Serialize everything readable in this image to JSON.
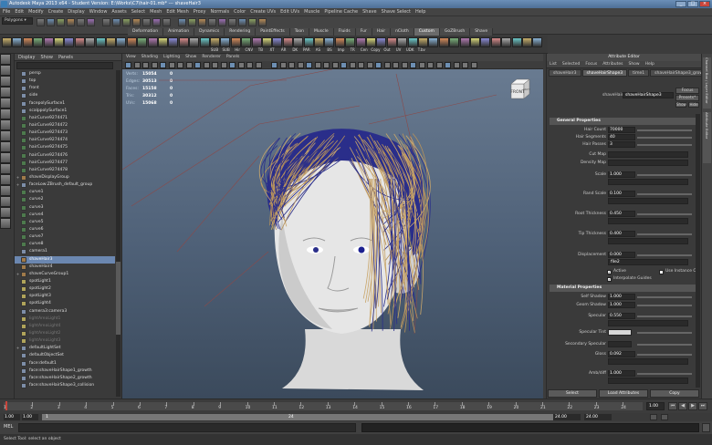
{
  "window": {
    "title": "Autodesk Maya 2013 x64 - Student Version: E:\\Works\\C7\\hair-01.mb* --- shaveHair3"
  },
  "menubar": [
    "File",
    "Edit",
    "Modify",
    "Create",
    "Display",
    "Window",
    "Assets",
    "Select",
    "Mesh",
    "Edit Mesh",
    "Proxy",
    "Normals",
    "Color",
    "Create UVs",
    "Edit UVs",
    "Muscle",
    "Pipeline Cache",
    "Shave",
    "Shave Select",
    "Help"
  ],
  "statusline": {
    "mode": "Polygons"
  },
  "shelf": {
    "tabs": [
      "Deformation",
      "Animation",
      "Dynamics",
      "Rendering",
      "PaintEffects",
      "Toon",
      "Muscle",
      "Fluids",
      "Fur",
      "Hair",
      "nCloth",
      "Custom",
      "GoZBrush",
      "Shave"
    ],
    "active_tab": "Custom",
    "labels": [
      "SUB",
      "SUB",
      "Hir",
      "CNV",
      "TB",
      "XT",
      "AR",
      "DK",
      "PAR",
      "AS",
      "BS",
      "Imp",
      "TR",
      "Cen",
      "Copy",
      "Out",
      "UV",
      "UDK",
      "T.bv"
    ]
  },
  "outliner": {
    "menu": [
      "Display",
      "Show",
      "Panels"
    ],
    "items": [
      {
        "label": "persp",
        "state": ""
      },
      {
        "label": "top",
        "state": ""
      },
      {
        "label": "front",
        "state": ""
      },
      {
        "label": "side",
        "state": ""
      },
      {
        "label": "facepolySurface1",
        "state": ""
      },
      {
        "label": "scalppolySurface1",
        "state": ""
      },
      {
        "label": "hairCurve9274471",
        "state": ""
      },
      {
        "label": "hairCurve9274472",
        "state": ""
      },
      {
        "label": "hairCurve9274473",
        "state": ""
      },
      {
        "label": "hairCurve9274474",
        "state": ""
      },
      {
        "label": "hairCurve9274475",
        "state": ""
      },
      {
        "label": "hairCurve9274476",
        "state": ""
      },
      {
        "label": "hairCurve9274477",
        "state": ""
      },
      {
        "label": "hairCurve9274478",
        "state": ""
      },
      {
        "label": "shaveDisplayGroup",
        "state": ""
      },
      {
        "label": "faceLow:ZBrush_default_group",
        "state": ""
      },
      {
        "label": "curve1",
        "state": ""
      },
      {
        "label": "curve2",
        "state": ""
      },
      {
        "label": "curve3",
        "state": ""
      },
      {
        "label": "curve4",
        "state": ""
      },
      {
        "label": "curve5",
        "state": ""
      },
      {
        "label": "curve6",
        "state": ""
      },
      {
        "label": "curve7",
        "state": ""
      },
      {
        "label": "curve8",
        "state": ""
      },
      {
        "label": "camera1",
        "state": ""
      },
      {
        "label": "shaveHair3",
        "state": "sel"
      },
      {
        "label": "shaveHair4",
        "state": ""
      },
      {
        "label": "shaveCurveGroup1",
        "state": ""
      },
      {
        "label": "spotLight1",
        "state": ""
      },
      {
        "label": "spotLight2",
        "state": ""
      },
      {
        "label": "spotLight3",
        "state": ""
      },
      {
        "label": "spotLight4",
        "state": ""
      },
      {
        "label": "camera3:camera3",
        "state": ""
      },
      {
        "label": "lightAreaLight1",
        "state": "dim"
      },
      {
        "label": "lightAreaLight4",
        "state": "dim"
      },
      {
        "label": "lightAreaLight2",
        "state": "dim"
      },
      {
        "label": "lightAreaLight3",
        "state": "dim"
      },
      {
        "label": "defaultLightSet",
        "state": ""
      },
      {
        "label": "defaultObjectSet",
        "state": ""
      },
      {
        "label": "face:default1",
        "state": ""
      },
      {
        "label": "face:shaveHairShape1_growth",
        "state": ""
      },
      {
        "label": "face:shaveHairShape2_growth",
        "state": ""
      },
      {
        "label": "face:shaveHairShape3_collision",
        "state": ""
      }
    ]
  },
  "viewport": {
    "menu": [
      "View",
      "Shading",
      "Lighting",
      "Show",
      "Renderer",
      "Panels"
    ],
    "hud": [
      {
        "key": "Verts:",
        "v1": "15054",
        "v2": "0"
      },
      {
        "key": "Edges:",
        "v1": "30513",
        "v2": "0"
      },
      {
        "key": "Faces:",
        "v1": "15158",
        "v2": "0"
      },
      {
        "key": "Tris:",
        "v1": "30312",
        "v2": "0"
      },
      {
        "key": "UVs:",
        "v1": "15068",
        "v2": "0"
      }
    ],
    "viewcube_label": "FRONT",
    "viewcube_side": "RIGHT"
  },
  "attribute_editor": {
    "title": "Attribute Editor",
    "menu": [
      "List",
      "Selected",
      "Focus",
      "Attributes",
      "Show",
      "Help"
    ],
    "tabs": [
      "shaveHair3",
      "shaveHairShape3",
      "time1",
      "shaveHairShape3_growth"
    ],
    "node_label": "shaveHair:",
    "node_value": "shaveHairShape3",
    "focus_label": "Focus",
    "presets_label": "Presets*",
    "show_label": "Show",
    "hide_label": "Hide",
    "sections": {
      "general": "General Properties",
      "material": "Material Properties"
    },
    "fields": [
      {
        "label": "Hair Count",
        "value": "70000"
      },
      {
        "label": "Hair Segments",
        "value": "40"
      },
      {
        "label": "Hair Passes",
        "value": "3"
      },
      {
        "label": "Cut Map",
        "value": ""
      },
      {
        "label": "Density Map",
        "value": ""
      },
      {
        "label": "Scale",
        "value": "1.000"
      },
      {
        "label": "Rand Scale",
        "value": "0.100"
      },
      {
        "label": "Root Thickness",
        "value": "0.450"
      },
      {
        "label": "Tip Thickness",
        "value": "0.400"
      },
      {
        "label": "Displacement",
        "value": "0.000"
      },
      {
        "label": "",
        "value": "file2"
      }
    ],
    "checks": [
      {
        "label": "Active",
        "checked": true
      },
      {
        "label": "Use Instance Ob",
        "checked": false
      },
      {
        "label": "Interpolate Guides",
        "checked": true
      }
    ],
    "mat_fields": [
      {
        "label": "Self Shadow",
        "value": "1.000"
      },
      {
        "label": "Geom Shadow",
        "value": "1.000"
      },
      {
        "label": "Specular",
        "value": "0.550"
      },
      {
        "label": "Specular Tint",
        "value": ""
      },
      {
        "label": "Secondary Specular",
        "value": ""
      },
      {
        "label": "Gloss",
        "value": "0.092"
      },
      {
        "label": "Amb/diff",
        "value": "1.000"
      }
    ],
    "buttons": [
      "Select",
      "Load Attributes",
      "Copy"
    ]
  },
  "side_tabs": [
    "Channel Box / Layer Editor",
    "Attribute Editor"
  ],
  "timeline": {
    "ticks": [
      "1",
      "2",
      "3",
      "4",
      "5",
      "6",
      "7",
      "8",
      "9",
      "10",
      "11",
      "12",
      "13",
      "14",
      "15",
      "16",
      "17",
      "18",
      "19",
      "20",
      "21",
      "22",
      "23",
      "24"
    ],
    "current": "1.00",
    "range_start": "1.00",
    "range_start2": "1.00",
    "range_value": "1",
    "range_end_marker": "24",
    "range_end": "24.00",
    "range_end2": "24.00"
  },
  "mel": {
    "label": "MEL"
  },
  "helpline": "Select Tool: select an object",
  "colors": {
    "accent": "#6b87b0",
    "hair_blue": "#2a2e8a",
    "hair_blond": "#c9a66b"
  }
}
